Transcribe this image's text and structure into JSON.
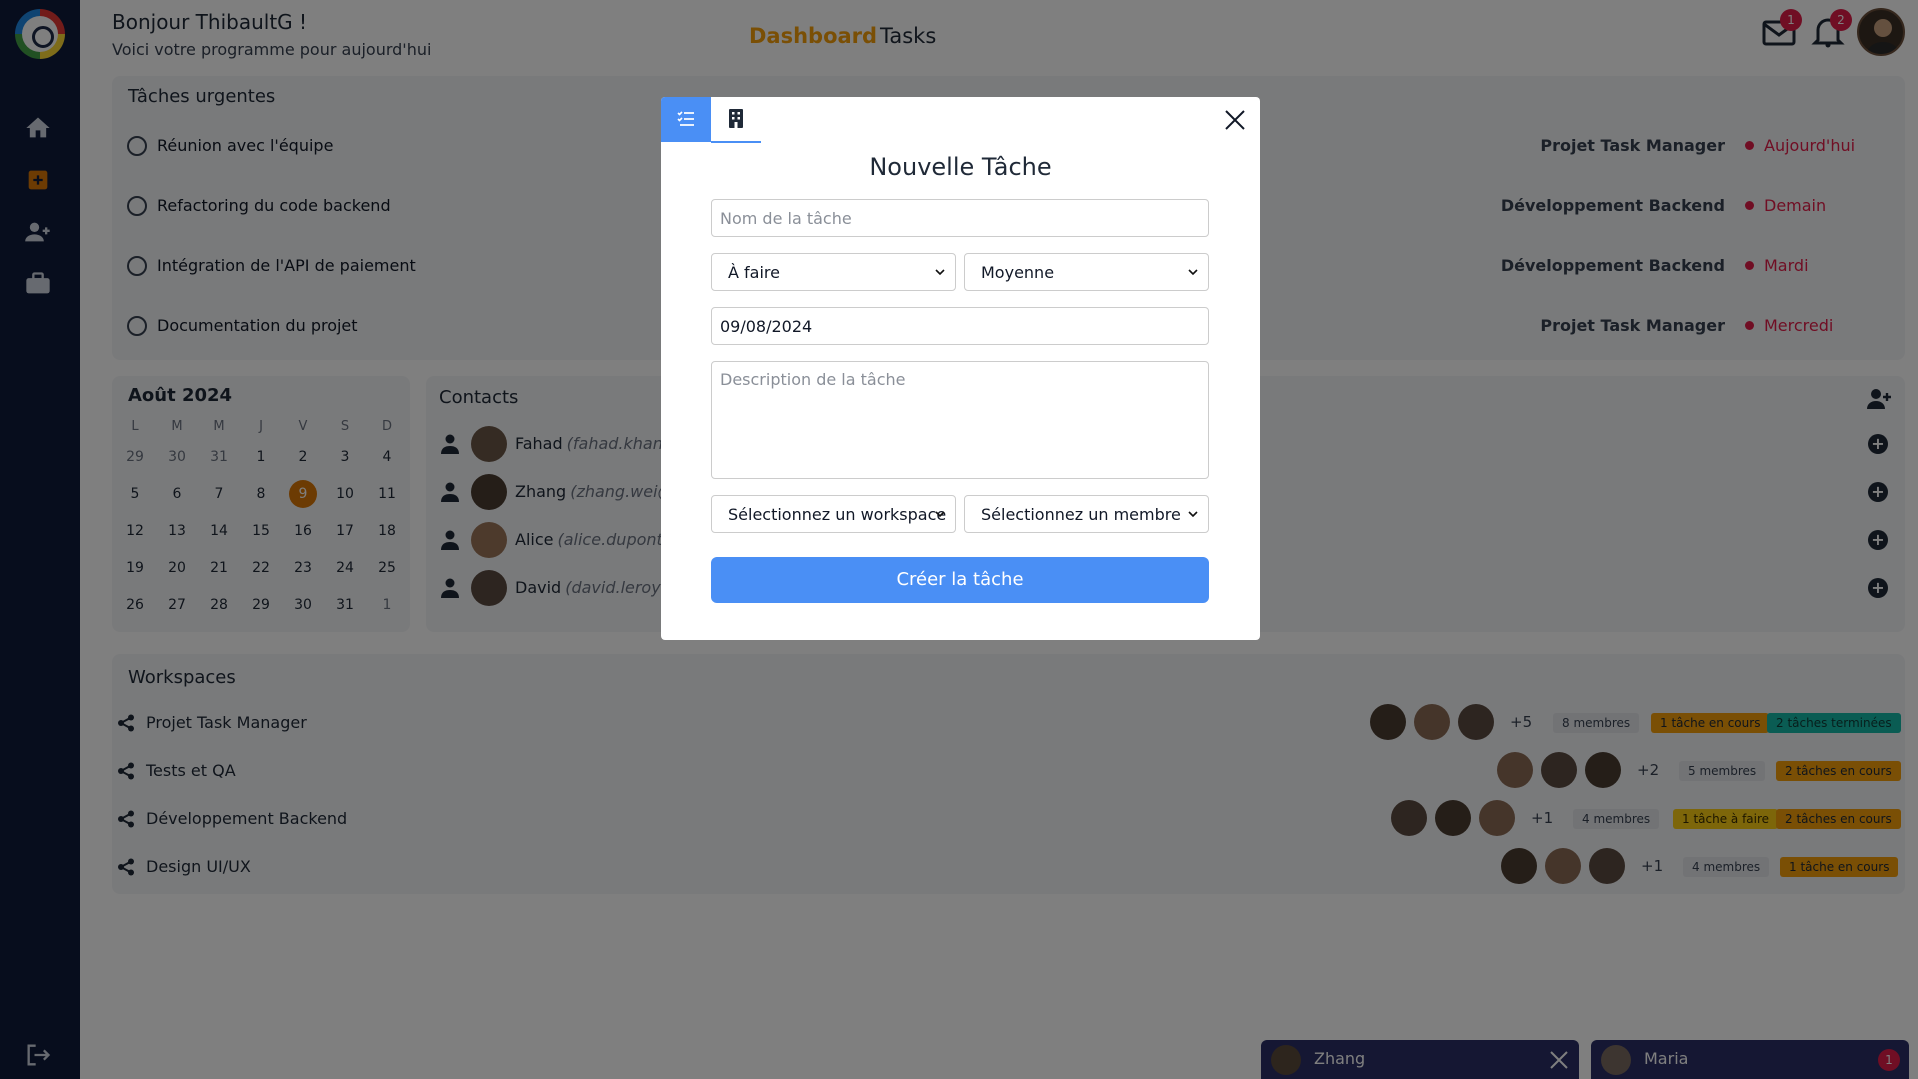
{
  "header": {
    "greeting": "Bonjour ThibaultG !",
    "subtitle": "Voici votre programme pour aujourd'hui",
    "nav": {
      "dashboard": "Dashboard",
      "tasks": "Tasks"
    },
    "mail_badge": "1",
    "notif_badge": "2"
  },
  "urgent": {
    "title": "Tâches urgentes",
    "tasks": [
      {
        "label": "Réunion avec l'équipe",
        "project": "Projet Task Manager",
        "when": "Aujourd'hui"
      },
      {
        "label": "Refactoring du code backend",
        "project": "Développement Backend",
        "when": "Demain"
      },
      {
        "label": "Intégration de l'API de paiement",
        "project": "Développement Backend",
        "when": "Mardi"
      },
      {
        "label": "Documentation du projet",
        "project": "Projet Task Manager",
        "when": "Mercredi"
      }
    ]
  },
  "calendar": {
    "title": "Août 2024",
    "weekdays": [
      "L",
      "M",
      "M",
      "J",
      "V",
      "S",
      "D"
    ],
    "weeks": [
      [
        "29",
        "30",
        "31",
        "1",
        "2",
        "3",
        "4"
      ],
      [
        "5",
        "6",
        "7",
        "8",
        "9",
        "10",
        "11"
      ],
      [
        "12",
        "13",
        "14",
        "15",
        "16",
        "17",
        "18"
      ],
      [
        "19",
        "20",
        "21",
        "22",
        "23",
        "24",
        "25"
      ],
      [
        "26",
        "27",
        "28",
        "29",
        "30",
        "31",
        "1"
      ]
    ],
    "today": "9"
  },
  "contacts": {
    "title": "Contacts",
    "items": [
      {
        "name": "Fahad",
        "email": "(fahad.khan@"
      },
      {
        "name": "Zhang",
        "email": "(zhang.wei@e"
      },
      {
        "name": "Alice",
        "email": "(alice.dupont@"
      },
      {
        "name": "David",
        "email": "(david.leroy@e"
      }
    ]
  },
  "workspaces": {
    "title": "Workspaces",
    "items": [
      {
        "name": "Projet Task Manager",
        "more": "+5",
        "members": "8 membres",
        "chips": [
          {
            "text": "1 tâche en cours",
            "color": "orange"
          },
          {
            "text": "2 tâches terminées",
            "color": "green"
          }
        ]
      },
      {
        "name": "Tests et QA",
        "more": "+2",
        "members": "5 membres",
        "chips": [
          {
            "text": "2 tâches en cours",
            "color": "orange"
          }
        ]
      },
      {
        "name": "Développement Backend",
        "more": "+1",
        "members": "4 membres",
        "chips": [
          {
            "text": "1 tâche à faire",
            "color": "yellow"
          },
          {
            "text": "2 tâches en cours",
            "color": "orange"
          }
        ]
      },
      {
        "name": "Design UI/UX",
        "more": "+1",
        "members": "4 membres",
        "chips": [
          {
            "text": "1 tâche en cours",
            "color": "orange"
          }
        ]
      }
    ]
  },
  "chats": [
    {
      "name": "Zhang"
    },
    {
      "name": "Maria",
      "badge": "1"
    }
  ],
  "modal": {
    "title": "Nouvelle Tâche",
    "name_placeholder": "Nom de la tâche",
    "status": "À faire",
    "priority": "Moyenne",
    "date": "09/08/2024",
    "description_placeholder": "Description de la tâche",
    "workspace": "Sélectionnez un workspace",
    "member": "Sélectionnez un membre",
    "submit": "Créer la tâche"
  },
  "colors": {
    "sidebar": "#0e1a3a",
    "accent": "#4a8ff5",
    "dashboard_active": "#f59e0b",
    "urgent": "#e11d48"
  }
}
